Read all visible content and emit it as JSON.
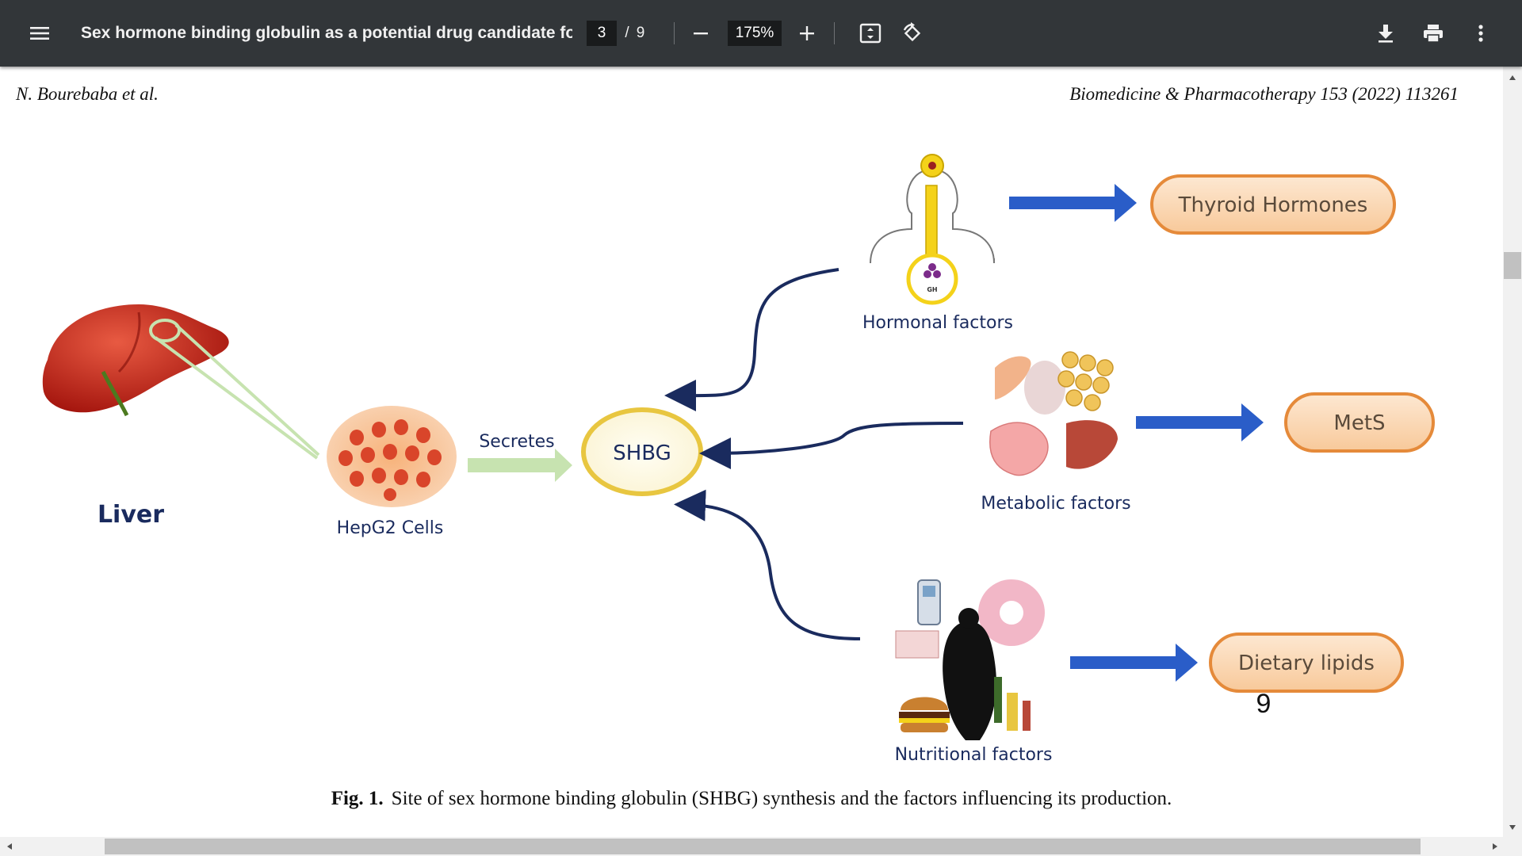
{
  "toolbar": {
    "title": "Sex hormone binding globulin as a potential drug candidate for ...",
    "current_page": "3",
    "page_separator": "/",
    "total_pages": "9",
    "zoom": "175%",
    "icons": [
      "menu-icon",
      "zoom-out-icon",
      "zoom-in-icon",
      "fit-page-icon",
      "rotate-icon",
      "download-icon",
      "print-icon",
      "more-vert-icon"
    ]
  },
  "page": {
    "header_left": "N. Bourebaba et al.",
    "header_right": "Biomedicine & Pharmacotherapy 153 (2022) 113261",
    "caption_label": "Fig. 1.",
    "caption_text": "Site of sex hormone binding globulin (SHBG) synthesis and the factors influencing its production."
  },
  "figure": {
    "liver": "Liver",
    "hepg2": "HepG2 Cells",
    "secretes": "Secretes",
    "shbg": "SHBG",
    "gh": "GH",
    "hormonal": "Hormonal factors",
    "metabolic": "Metabolic factors",
    "nutritional": "Nutritional factors",
    "thyroid": "Thyroid Hormones",
    "mets": "MetS",
    "dietary": "Dietary lipids",
    "stray_number": "9"
  },
  "colors": {
    "toolbar_bg": "#323639",
    "navy": "#1a2b5e",
    "blue_arrow": "#2a5dc8",
    "green_arrow": "#c7e3b0",
    "pill_fill": "#fbd9b8",
    "pill_border": "#e58a3a",
    "shbg_ring": "#e8c640",
    "liver_red": "#c4271c"
  }
}
